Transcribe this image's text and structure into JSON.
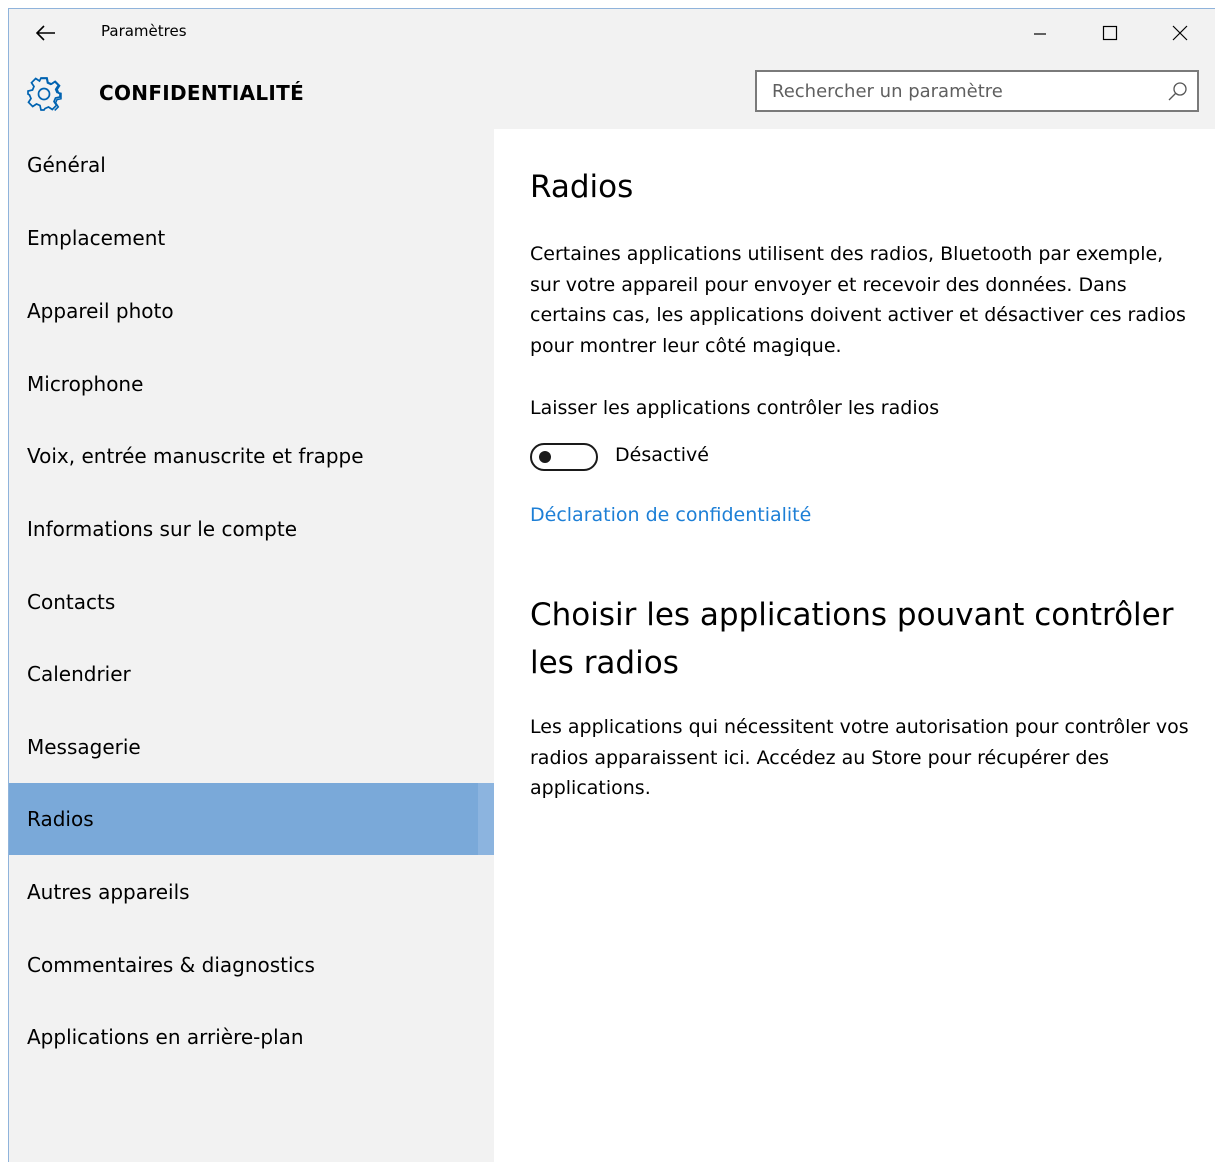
{
  "window": {
    "title": "Paramètres",
    "back_icon": "arrow-left-icon",
    "minimize_icon": "minimize-icon",
    "maximize_icon": "maximize-icon",
    "close_icon": "close-icon"
  },
  "header": {
    "icon": "gear-icon",
    "title": "CONFIDENTIALITÉ",
    "accent_color": "#0063b1"
  },
  "search": {
    "placeholder": "Rechercher un paramètre",
    "value": "",
    "icon": "search-icon"
  },
  "sidebar": {
    "selected_color": "#7aa9d9",
    "items": [
      {
        "label": "Général"
      },
      {
        "label": "Emplacement"
      },
      {
        "label": "Appareil photo"
      },
      {
        "label": "Microphone"
      },
      {
        "label": "Voix, entrée manuscrite et frappe"
      },
      {
        "label": "Informations sur le compte"
      },
      {
        "label": "Contacts"
      },
      {
        "label": "Calendrier"
      },
      {
        "label": "Messagerie"
      },
      {
        "label": "Radios"
      },
      {
        "label": "Autres appareils"
      },
      {
        "label": "Commentaires & diagnostics"
      },
      {
        "label": "Applications en arrière-plan"
      }
    ],
    "selected_index": 9
  },
  "main": {
    "heading": "Radios",
    "description": "Certaines applications utilisent des radios, Bluetooth par exemple, sur votre appareil pour envoyer et recevoir des données. Dans certains cas, les applications doivent activer et désactiver ces radios pour montrer leur côté magique.",
    "toggle_label": "Laisser les applications contrôler les radios",
    "toggle_state_text": "Désactivé",
    "toggle_on": false,
    "privacy_link": "Déclaration de confidentialité",
    "link_color": "#1d7fd6",
    "subheading": "Choisir les applications pouvant contrôler les radios",
    "subdescription": "Les applications qui nécessitent votre autorisation pour contrôler vos radios apparaissent ici. Accédez au Store pour récupérer des applications."
  }
}
